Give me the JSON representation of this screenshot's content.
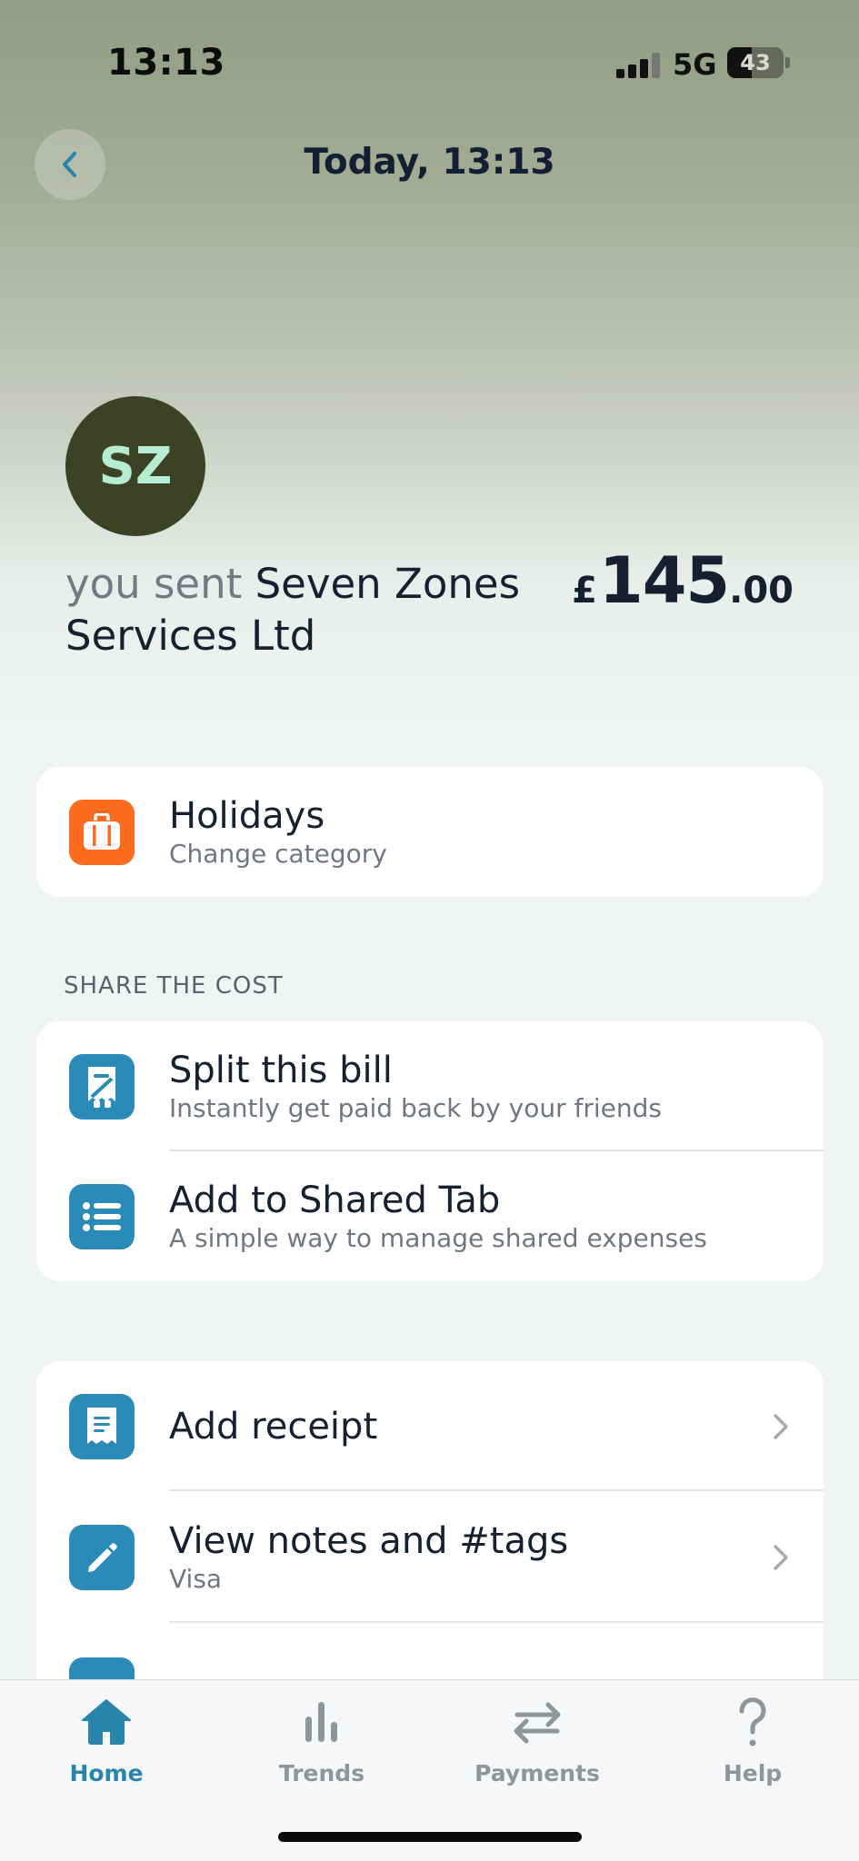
{
  "status_bar": {
    "time": "13:13",
    "network": "5G",
    "battery": "43",
    "battery_level": 0.43
  },
  "header": {
    "title": "Today, 13:13"
  },
  "transaction": {
    "avatar_initials": "SZ",
    "prefix": "you sent",
    "merchant": "Seven Zones Services Ltd",
    "amount_currency": "£",
    "amount_major": "145",
    "amount_minor": ".00"
  },
  "category": {
    "title": "Holidays",
    "subtitle": "Change category",
    "icon": "suitcase-icon",
    "color": "#fb6a1f"
  },
  "share_section": {
    "label": "SHARE THE COST",
    "items": [
      {
        "title": "Split this bill",
        "subtitle": "Instantly get paid back by your friends",
        "icon": "split-bill-icon"
      },
      {
        "title": "Add to Shared Tab",
        "subtitle": "A simple way to manage shared expenses",
        "icon": "list-icon"
      }
    ]
  },
  "actions": {
    "items": [
      {
        "title": "Add receipt",
        "icon": "receipt-icon"
      },
      {
        "title": "View notes and #tags",
        "subtitle": "Visa",
        "icon": "pencil-icon"
      }
    ]
  },
  "tab_bar": {
    "tabs": [
      {
        "label": "Home",
        "icon": "home-icon",
        "active": true
      },
      {
        "label": "Trends",
        "icon": "bar-chart-icon",
        "active": false
      },
      {
        "label": "Payments",
        "icon": "transfer-arrows-icon",
        "active": false
      },
      {
        "label": "Help",
        "icon": "question-icon",
        "active": false
      }
    ]
  },
  "colors": {
    "accent": "#2a85ad",
    "icon_blue": "#2a8ab8",
    "category_orange": "#fb6a1f",
    "avatar_bg": "#3c4324",
    "avatar_text": "#b6edd2"
  }
}
